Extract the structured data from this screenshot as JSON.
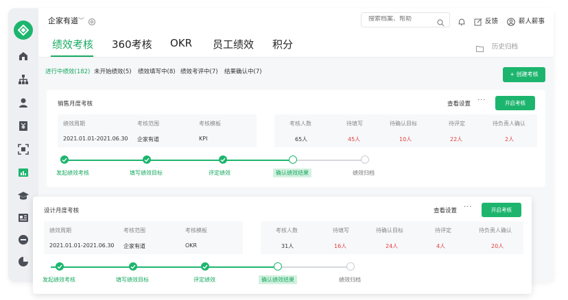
{
  "header": {
    "company": "企家有道",
    "search_placeholder": "搜索档案、帮助",
    "feedback": "反馈",
    "user": "薪人薪事"
  },
  "tabs": [
    "绩效考核",
    "360考核",
    "OKR",
    "员工绩效",
    "积分"
  ],
  "history": "历史归档",
  "subtabs": [
    "进行中绩效(182)",
    "未开始绩效(5)",
    "绩效填写中(8)",
    "绩效考评中(7)",
    "结果确认中(7)"
  ],
  "create_button": "+ 创建考核",
  "cards": [
    {
      "title": "销售月度考核",
      "settings": "查看设置",
      "more": "···",
      "start": "开启考核",
      "left_headers": [
        "绩效周期",
        "考核范围",
        "考核模板"
      ],
      "left_values": [
        "2021.01.01-2021.06.30",
        "企家有道",
        "KPI"
      ],
      "right_headers": [
        "考核人数",
        "待填写",
        "待确认目标",
        "待评定",
        "待负责人确认"
      ],
      "right_values": [
        "65人",
        "45人",
        "10人",
        "22人",
        "2人"
      ],
      "steps": [
        "发起绩效考核",
        "填写绩效目标",
        "评定绩效",
        "确认绩效结果",
        "绩效归档"
      ]
    },
    {
      "title": "设计月度考核",
      "settings": "查看设置",
      "more": "···",
      "start": "开启考核",
      "left_headers": [
        "绩效周期",
        "考核范围",
        "考核模板"
      ],
      "left_values": [
        "2021.01.01-2021.06.30",
        "企家有道",
        "OKR"
      ],
      "right_headers": [
        "考核人数",
        "待填写",
        "待确认目标",
        "待评定",
        "待负责人确认"
      ],
      "right_values": [
        "31人",
        "16人",
        "24人",
        "4人",
        "20人"
      ],
      "steps": [
        "发起绩效考核",
        "填写绩效目标",
        "评定绩效",
        "确认绩效结果",
        "绩效归档"
      ]
    }
  ],
  "colors": {
    "accent": "#1db56e",
    "alert": "#e23b3b"
  },
  "sidebar_icons": [
    "home-icon",
    "org-chart-icon",
    "person-icon",
    "salary-icon",
    "scan-icon",
    "chart-bar-icon",
    "graduation-cap-icon",
    "id-card-icon",
    "minus-circle-icon",
    "pie-chart-icon"
  ]
}
